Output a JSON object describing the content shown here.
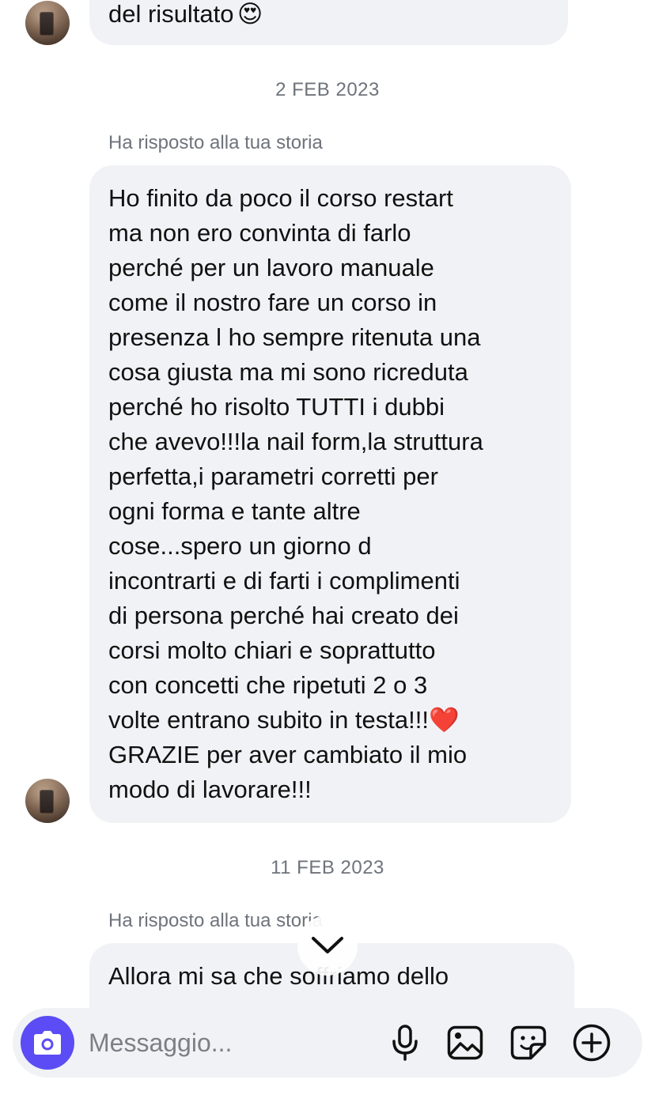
{
  "messages": [
    {
      "text": "del risultato",
      "emoji": "😍"
    },
    {
      "date": "2 FEB 2023",
      "reply_label": "Ha risposto alla tua storia",
      "text": "Ho finito da poco il corso restart\nma non ero convinta di farlo\nperché per un lavoro manuale\ncome il nostro fare un corso in\npresenza l ho sempre ritenuta una\ncosa giusta ma mi sono ricreduta\nperché ho risolto TUTTI i dubbi\nche avevo!!!la nail form,la struttura\nperfetta,i parametri corretti per\nogni forma e tante altre\ncose...spero un giorno d\nincontrarti e di farti i complimenti\ndi persona perché hai creato dei\ncorsi molto chiari e soprattutto\ncon concetti che ripetuti 2 o 3\nvolte entrano subito in testa!!!",
      "emoji": "❤️",
      "text_after": "\nGRAZIE per aver cambiato il mio\nmodo di lavorare!!!"
    },
    {
      "date": "11 FEB 2023",
      "reply_label": "Ha risposto alla tua storia",
      "text": "Allora mi sa che soffriamo dello"
    }
  ],
  "composer": {
    "placeholder": "Messaggio...",
    "icons": [
      "camera-icon",
      "microphone-icon",
      "gallery-icon",
      "sticker-icon",
      "plus-icon"
    ],
    "accent_color": "#5b4cf5"
  },
  "scroll_button": {
    "icon": "chevron-down-icon"
  }
}
